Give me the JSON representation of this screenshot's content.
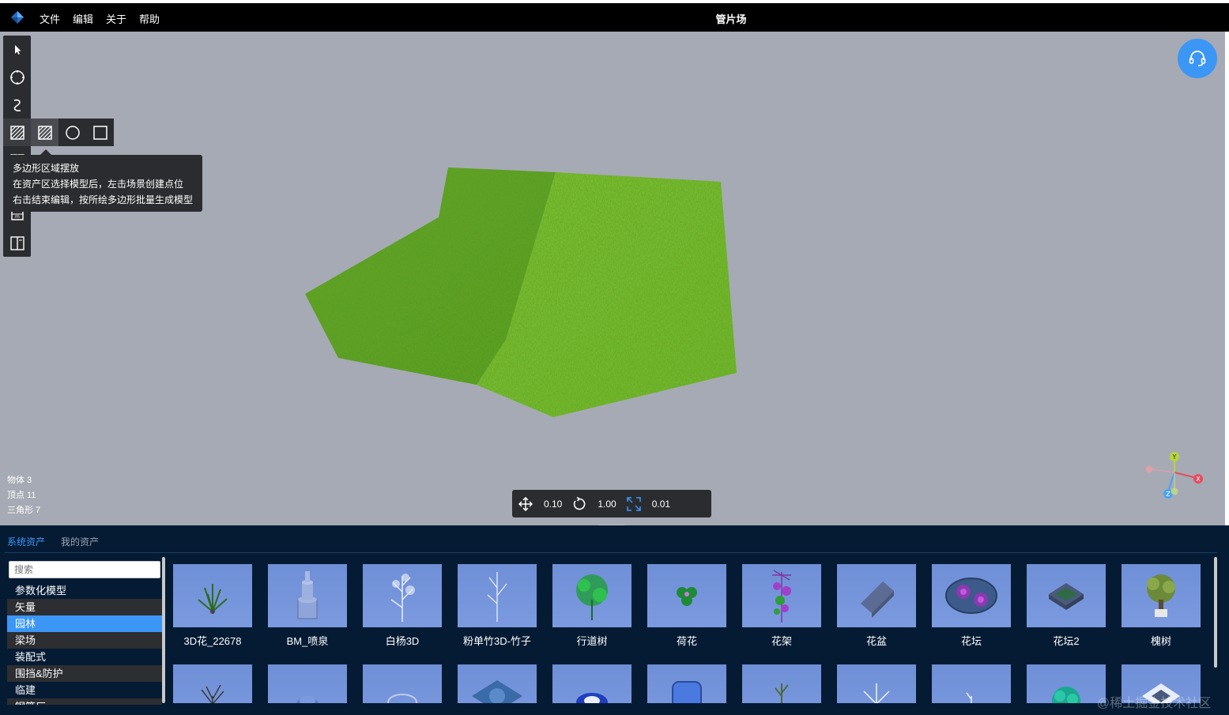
{
  "app": {
    "title": "管片场",
    "menu": [
      "文件",
      "编辑",
      "关于",
      "帮助"
    ]
  },
  "tooltip": {
    "lines": [
      "多边形区域摆放",
      "在资产区选择模型后，左击场景创建点位",
      "右击结束编辑，按所绘多边形批量生成模型"
    ]
  },
  "stats": {
    "objects": "物体 3",
    "vertices": "顶点 11",
    "triangles": "三角形 7"
  },
  "transform": {
    "move": "0.10",
    "rotate": "1.00",
    "scale": "0.01"
  },
  "gizmo": {
    "y": "Y",
    "x": "X",
    "z": "Z"
  },
  "panel": {
    "tabs": [
      {
        "label": "系统资产",
        "active": true
      },
      {
        "label": "我的资产",
        "active": false
      }
    ],
    "search_placeholder": "搜索",
    "categories": [
      "参数化模型",
      "矢量",
      "园林",
      "梁场",
      "装配式",
      "围挡&防护",
      "临建",
      "钢筋厂"
    ],
    "selected_category": "园林",
    "assets_row1": [
      "3D花_22678",
      "BM_喷泉",
      "白杨3D",
      "粉单竹3D-竹子",
      "行道树",
      "荷花",
      "花架",
      "花盆",
      "花坛",
      "花坛2",
      "槐树"
    ]
  },
  "watermark": "@稀土掘金技术社区",
  "colors": {
    "accent": "#3b96f5",
    "viewport_bg": "#a6aab4",
    "panel_bg": "#051b34",
    "topbar_bg": "#000000"
  },
  "icons": {
    "toolbar": [
      "pointer-icon",
      "circle-select-icon",
      "curve-icon",
      "polygon-area-icon",
      "grid-icon",
      "measure-icon",
      "split-view-icon"
    ],
    "subbar": [
      "polygon-area-icon",
      "polygon-area-alt-icon",
      "circle-area-icon",
      "rect-area-icon"
    ],
    "transform": [
      "move-icon",
      "rotate-icon",
      "scale-icon"
    ],
    "support": "headset-icon"
  }
}
